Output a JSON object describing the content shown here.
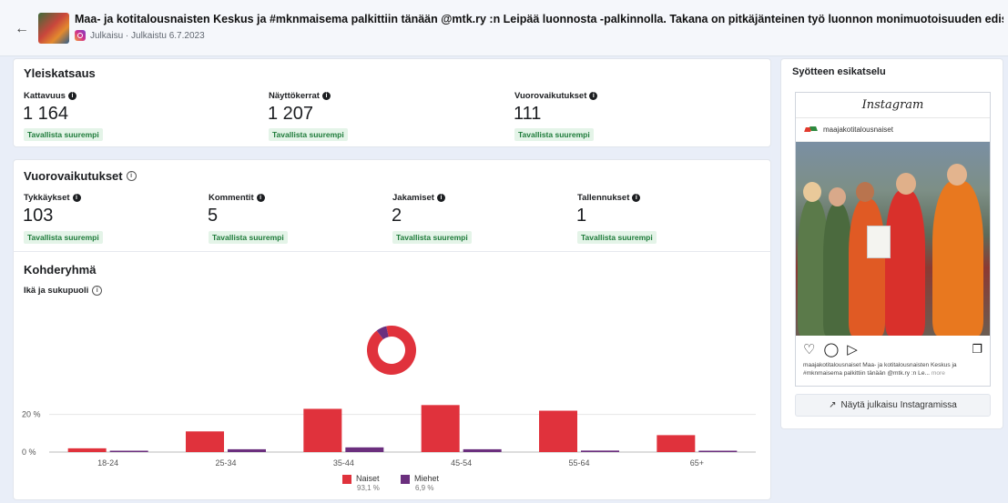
{
  "header": {
    "title": "Maa- ja kotitalousnaisten Keskus ja #mknmaisema palkittiin tänään @mtk.ry :n Leipää luonnosta -palkinnolla. Takana on pitkäjänteinen työ luonnon monimuotoisuuden edistämiseksi maaseudun elinkeinoi",
    "meta": "Julkaisu · Julkaistu 6.7.2023"
  },
  "overview": {
    "title": "Yleiskatsaus",
    "metrics": [
      {
        "label": "Kattavuus",
        "value": "1 164",
        "badge": "Tavallista suurempi"
      },
      {
        "label": "Näyttökerrat",
        "value": "1 207",
        "badge": "Tavallista suurempi"
      },
      {
        "label": "Vuorovaikutukset",
        "value": "111",
        "badge": "Tavallista suurempi"
      }
    ]
  },
  "interactions": {
    "title": "Vuorovaikutukset",
    "metrics": [
      {
        "label": "Tykkäykset",
        "value": "103",
        "badge": "Tavallista suurempi"
      },
      {
        "label": "Kommentit",
        "value": "5",
        "badge": "Tavallista suurempi"
      },
      {
        "label": "Jakamiset",
        "value": "2",
        "badge": "Tavallista suurempi"
      },
      {
        "label": "Tallennukset",
        "value": "1",
        "badge": "Tavallista suurempi"
      }
    ]
  },
  "audience": {
    "title": "Kohderyhmä",
    "subtitle": "Ikä ja sukupuoli"
  },
  "chart_data": [
    {
      "type": "pie",
      "categories": [
        "Naiset",
        "Miehet"
      ],
      "values": [
        93.1,
        6.9
      ],
      "colors": [
        "#e0323c",
        "#6b2f7e"
      ]
    },
    {
      "type": "bar",
      "categories": [
        "18-24",
        "25-34",
        "35-44",
        "45-54",
        "55-64",
        "65+"
      ],
      "series": [
        {
          "name": "Naiset",
          "values": [
            2,
            11,
            23,
            25,
            22,
            9
          ],
          "color": "#e0323c"
        },
        {
          "name": "Miehet",
          "values": [
            0.5,
            1.5,
            2.5,
            1.5,
            0.8,
            0.3
          ],
          "color": "#6b2f7e"
        }
      ],
      "yticks": [
        "20 %",
        "0 %"
      ],
      "ylim": [
        0,
        30
      ],
      "legend": [
        {
          "name": "Naiset",
          "pct": "93,1 %"
        },
        {
          "name": "Miehet",
          "pct": "6,9 %"
        }
      ],
      "legend_placement": "bottom-center",
      "grid": false
    }
  ],
  "preview": {
    "title": "Syötteen esikatselu",
    "ig_logo": "Instagram",
    "account": "maajakotitalousnaiset",
    "caption": "maajakotitalousnaiset Maa- ja kotitalousnaisten Keskus ja #mknmaisema palkittiin tänään @mtk.ry :n Le...",
    "more": "more",
    "view_button": "Näytä julkaisu Instagramissa"
  },
  "icons": {
    "back": "arrow-left-icon",
    "instagram": "instagram-icon",
    "info": "info-icon",
    "heart": "heart-icon",
    "comment": "comment-icon",
    "share": "send-icon",
    "save": "bookmark-icon",
    "external": "external-link-icon"
  }
}
